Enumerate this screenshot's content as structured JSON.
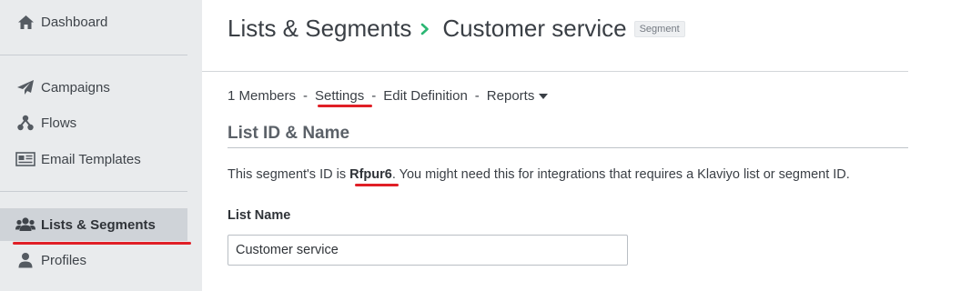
{
  "sidebar": {
    "items": [
      {
        "key": "dashboard",
        "label": "Dashboard",
        "icon": "home-icon",
        "active": false
      },
      {
        "key": "campaigns",
        "label": "Campaigns",
        "icon": "paper-plane-icon",
        "active": false
      },
      {
        "key": "flows",
        "label": "Flows",
        "icon": "flows-icon",
        "active": false
      },
      {
        "key": "email_templates",
        "label": "Email Templates",
        "icon": "newspaper-icon",
        "active": false
      },
      {
        "key": "lists_segments",
        "label": "Lists & Segments",
        "icon": "users-icon",
        "active": true
      },
      {
        "key": "profiles",
        "label": "Profiles",
        "icon": "user-icon",
        "active": false
      }
    ]
  },
  "header": {
    "breadcrumb_parent": "Lists & Segments",
    "breadcrumb_separator_icon": "chevron-right-icon",
    "title": "Customer service",
    "badge": "Segment"
  },
  "subnav": {
    "members": "1 Members",
    "separator": "-",
    "settings": "Settings",
    "edit_definition": "Edit Definition",
    "reports": "Reports",
    "reports_icon": "caret-down-icon"
  },
  "section": {
    "title": "List ID & Name",
    "desc_prefix": "This segment's ID is ",
    "segment_id": "Rfpur6",
    "desc_suffix": ". You might need this for integrations that requires a Klaviyo list or segment ID."
  },
  "form": {
    "list_name_label": "List Name",
    "list_name_value": "Customer service"
  },
  "colors": {
    "sidebar_bg": "#e9ebed",
    "active_bg": "#cfd3d8",
    "accent_green": "#2bb673",
    "highlight_red": "#e01f26"
  }
}
